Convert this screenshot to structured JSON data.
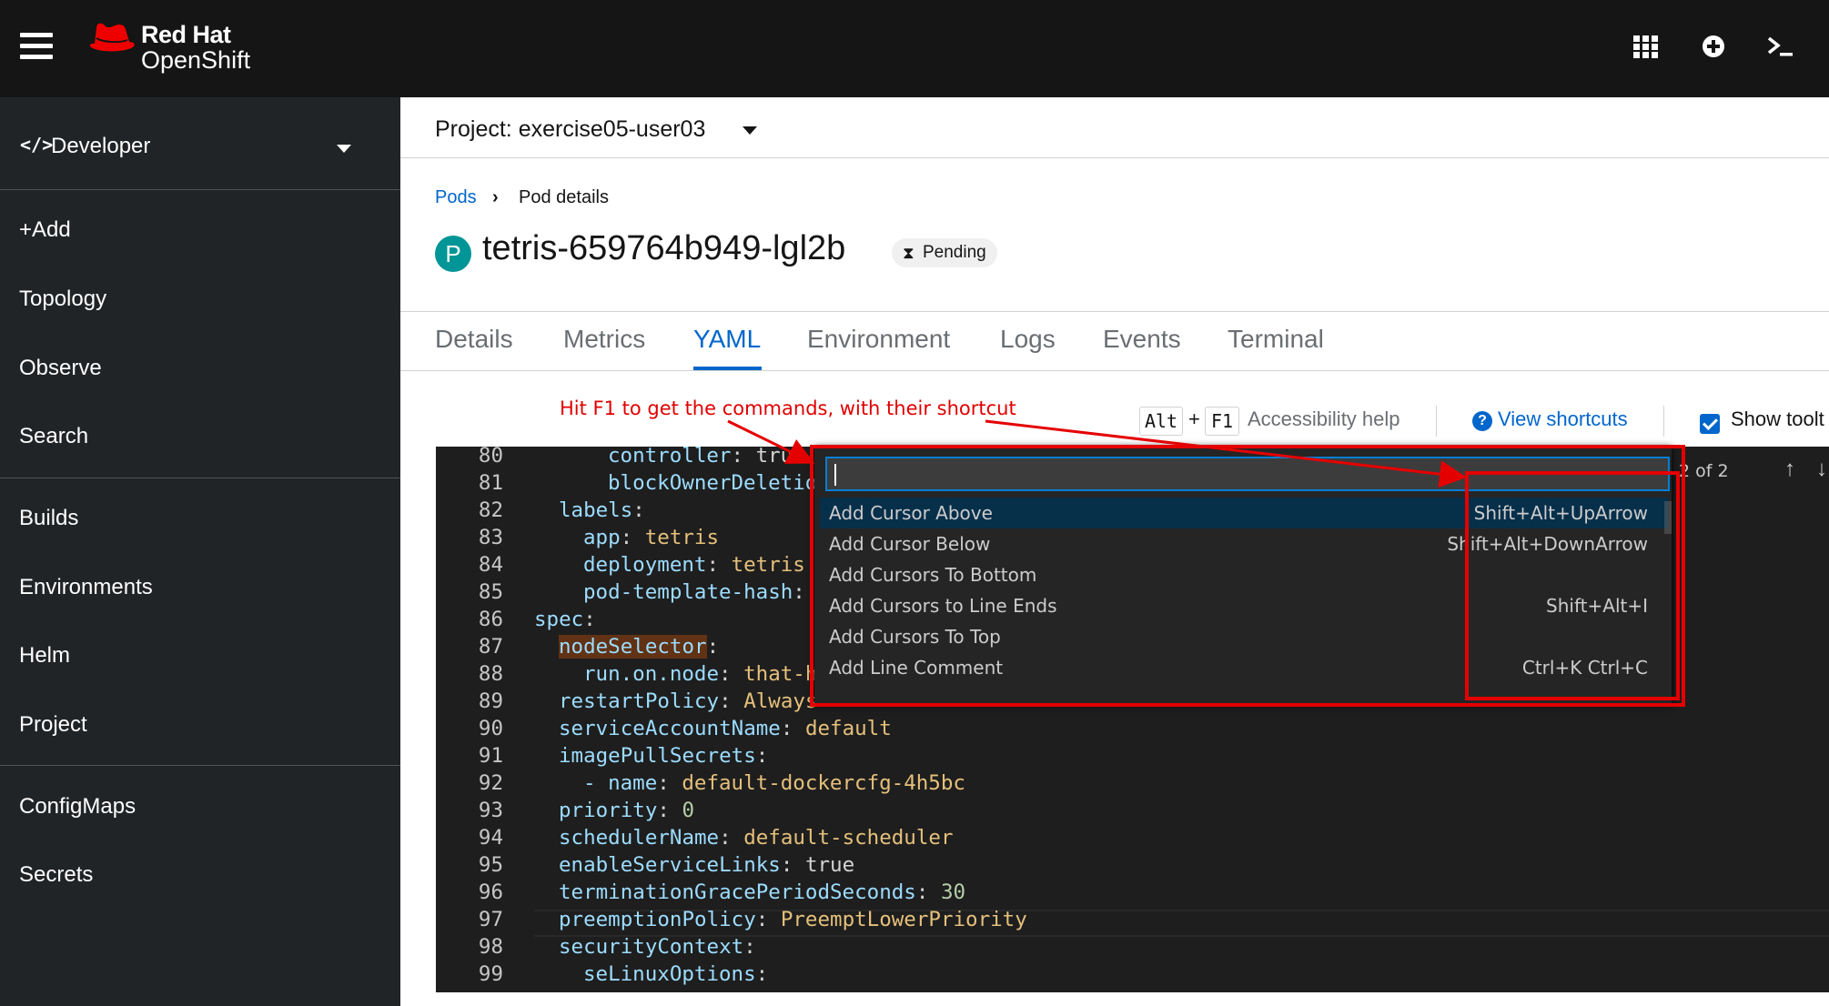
{
  "masthead": {
    "brand_line1": "Red Hat",
    "brand_line2": "OpenShift"
  },
  "sidebar": {
    "perspective": "Developer",
    "items": [
      "+Add",
      "Topology",
      "Observe",
      "Search",
      "Builds",
      "Environments",
      "Helm",
      "Project",
      "ConfigMaps",
      "Secrets"
    ]
  },
  "project": {
    "label": "Project: exercise05-user03"
  },
  "breadcrumb": {
    "link": "Pods",
    "current": "Pod details"
  },
  "pod": {
    "badge": "P",
    "name": "tetris-659764b949-lgl2b",
    "status": "Pending"
  },
  "tabs": [
    "Details",
    "Metrics",
    "YAML",
    "Environment",
    "Logs",
    "Events",
    "Terminal"
  ],
  "toolbar": {
    "key1": "Alt",
    "plus": "+",
    "key2": "F1",
    "accessibility": "Accessibility help",
    "view_shortcuts": "View shortcuts",
    "show_tooltips": "Show toolt"
  },
  "annotation": "Hit F1 to get the commands, with their shortcut",
  "editor": {
    "lines": [
      {
        "n": "80",
        "indent": 3,
        "key": "controller",
        "val": "true",
        "cls": "p"
      },
      {
        "n": "81",
        "indent": 3,
        "key": "blockOwnerDeletion",
        "val": "",
        "cls": "p"
      },
      {
        "n": "82",
        "indent": 1,
        "key": "labels",
        "val": "",
        "cls": "p"
      },
      {
        "n": "83",
        "indent": 2,
        "key": "app",
        "val": "tetris",
        "cls": "s"
      },
      {
        "n": "84",
        "indent": 2,
        "key": "deployment",
        "val": "tetris",
        "cls": "s"
      },
      {
        "n": "85",
        "indent": 2,
        "key": "pod-template-hash",
        "val": "",
        "cls": "s"
      },
      {
        "n": "86",
        "indent": 0,
        "key": "spec",
        "val": "",
        "cls": "p"
      },
      {
        "n": "87",
        "indent": 1,
        "key": "nodeSelector",
        "val": "",
        "cls": "p"
      },
      {
        "n": "88",
        "indent": 2,
        "key": "run.on.node",
        "val": "that-ha",
        "cls": "s"
      },
      {
        "n": "89",
        "indent": 1,
        "key": "restartPolicy",
        "val": "Always",
        "cls": "s"
      },
      {
        "n": "90",
        "indent": 1,
        "key": "serviceAccountName",
        "val": "default",
        "cls": "s"
      },
      {
        "n": "91",
        "indent": 1,
        "key": "imagePullSecrets",
        "val": "",
        "cls": "p"
      },
      {
        "n": "92",
        "indent": 2,
        "key": "- name",
        "val": "default-dockercfg-4h5bc",
        "cls": "s"
      },
      {
        "n": "93",
        "indent": 1,
        "key": "priority",
        "val": "0",
        "cls": "n"
      },
      {
        "n": "94",
        "indent": 1,
        "key": "schedulerName",
        "val": "default-scheduler",
        "cls": "s"
      },
      {
        "n": "95",
        "indent": 1,
        "key": "enableServiceLinks",
        "val": "true",
        "cls": "p"
      },
      {
        "n": "96",
        "indent": 1,
        "key": "terminationGracePeriodSeconds",
        "val": "30",
        "cls": "n"
      },
      {
        "n": "97",
        "indent": 1,
        "key": "preemptionPolicy",
        "val": "PreemptLowerPriority",
        "cls": "s"
      },
      {
        "n": "98",
        "indent": 1,
        "key": "securityContext",
        "val": "",
        "cls": "p"
      },
      {
        "n": "99",
        "indent": 2,
        "key": "seLinuxOptions",
        "val": "",
        "cls": "p"
      }
    ]
  },
  "palette": {
    "items": [
      {
        "label": "Add Cursor Above",
        "shortcut": "Shift+Alt+UpArrow"
      },
      {
        "label": "Add Cursor Below",
        "shortcut": "Shift+Alt+DownArrow"
      },
      {
        "label": "Add Cursors To Bottom",
        "shortcut": ""
      },
      {
        "label": "Add Cursors to Line Ends",
        "shortcut": "Shift+Alt+I"
      },
      {
        "label": "Add Cursors To Top",
        "shortcut": ""
      },
      {
        "label": "Add Line Comment",
        "shortcut": "Ctrl+K Ctrl+C"
      }
    ]
  },
  "find": {
    "count": "2 of 2"
  },
  "colors": {
    "accent": "#0066cc",
    "masthead": "#151515",
    "sidebar": "#212427",
    "annotation": "#e50000",
    "pod_badge": "#009596"
  }
}
